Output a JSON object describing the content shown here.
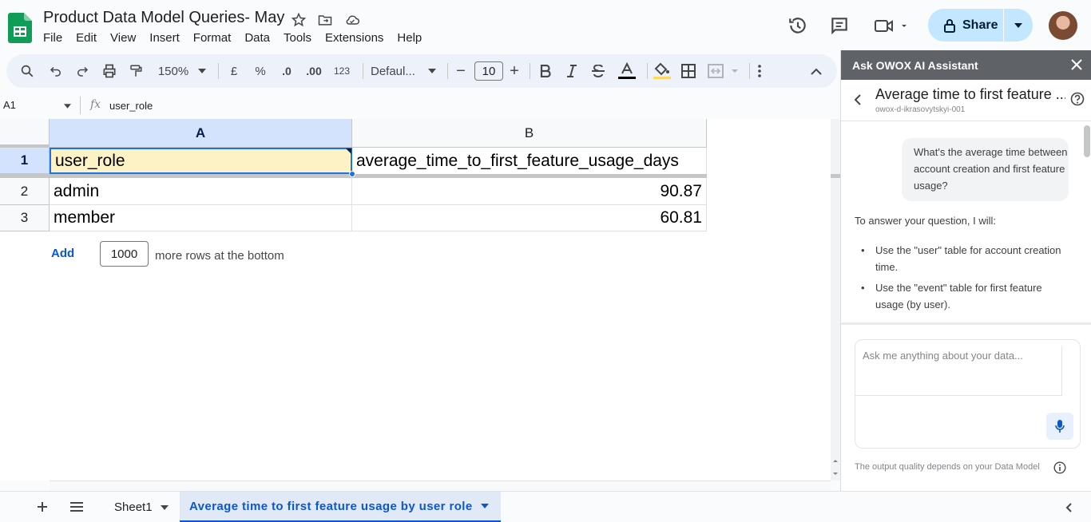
{
  "document": {
    "title": "Product Data Model Queries- May",
    "menus": [
      "File",
      "Edit",
      "View",
      "Insert",
      "Format",
      "Data",
      "Tools",
      "Extensions",
      "Help"
    ],
    "share_label": "Share"
  },
  "toolbar": {
    "zoom": "150%",
    "currency": "£",
    "percent": "%",
    "decrease_decimal": ".0",
    "increase_decimal": ".00",
    "number_format": "123",
    "font": "Defaul...",
    "font_size": "10",
    "minus": "−",
    "plus": "+"
  },
  "formula_bar": {
    "cell_ref": "A1",
    "fx": "fx",
    "value": "user_role"
  },
  "sheet": {
    "columns": [
      "A",
      "B"
    ],
    "rows": [
      {
        "num": "1",
        "a": "user_role",
        "b": "average_time_to_first_feature_usage_days"
      },
      {
        "num": "2",
        "a": "admin",
        "b": "90.87"
      },
      {
        "num": "3",
        "a": "member",
        "b": "60.81"
      }
    ],
    "add_label": "Add",
    "add_rows_count": "1000",
    "add_rows_suffix": "more rows at the bottom"
  },
  "assistant": {
    "header": "Ask OWOX AI Assistant",
    "chat_title": "Average time to first feature ...",
    "chat_subtitle": "owox-d-ikrasovytskyi-001",
    "user_message": "What's the average time between account creation and first feature usage?",
    "answer_intro": "To answer your question, I will:",
    "answer_points": [
      "Use the \"user\" table for account creation time.",
      "Use the \"event\" table for first feature usage (by user)."
    ],
    "input_placeholder": "Ask me anything about your data...",
    "footnote": "The output quality depends on your Data Model"
  },
  "tabs": {
    "sheets": [
      {
        "label": "Sheet1",
        "active": false
      },
      {
        "label": "Average time to first feature usage by user role",
        "active": true
      }
    ]
  },
  "colors": {
    "accent": "#0b57d0",
    "share_bg": "#c2e7ff",
    "selected_cell": "#fdf2c5",
    "panel_header": "#5f6368"
  }
}
